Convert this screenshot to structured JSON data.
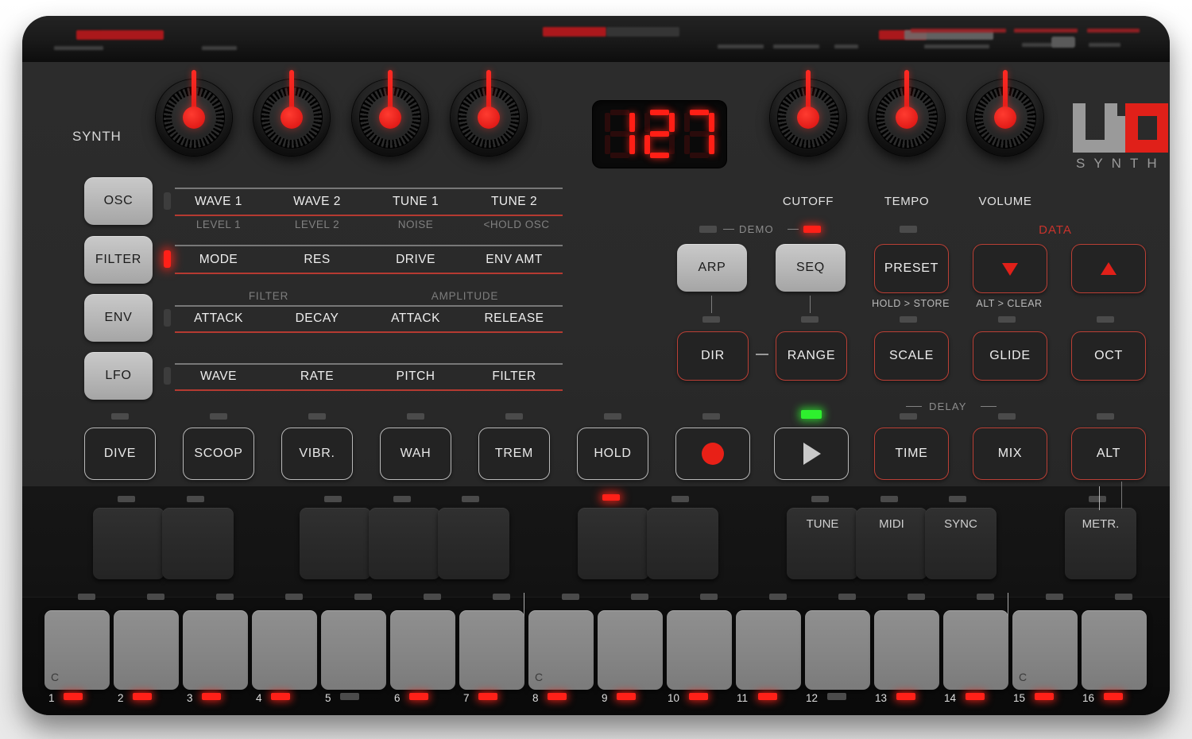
{
  "device": {
    "brand_logo": "UNO",
    "brand_sub": "SYNTH",
    "section_title": "SYNTH"
  },
  "display": {
    "value": "127",
    "digits": [
      "1",
      "2",
      "7"
    ]
  },
  "synth_section_buttons": [
    {
      "label": "OSC",
      "led": "off"
    },
    {
      "label": "FILTER",
      "led": "on"
    },
    {
      "label": "ENV",
      "led": "off"
    },
    {
      "label": "LFO",
      "led": "off"
    }
  ],
  "left_knobs": [
    {
      "label": "WAVE 1"
    },
    {
      "label": "WAVE 2"
    },
    {
      "label": "TUNE 1"
    },
    {
      "label": "TUNE 2"
    }
  ],
  "right_knobs": [
    {
      "label": "CUTOFF"
    },
    {
      "label": "TEMPO"
    },
    {
      "label": "VOLUME"
    }
  ],
  "param_rows": [
    {
      "row": "osc",
      "primary": [
        "WAVE 1",
        "WAVE 2",
        "TUNE 1",
        "TUNE 2"
      ],
      "secondary": [
        "LEVEL 1",
        "LEVEL 2",
        "NOISE",
        "<HOLD OSC"
      ],
      "group_labels": []
    },
    {
      "row": "filter",
      "primary": [
        "MODE",
        "RES",
        "DRIVE",
        "ENV AMT"
      ],
      "secondary": [],
      "group_labels": []
    },
    {
      "row": "env",
      "primary": [
        "ATTACK",
        "DECAY",
        "ATTACK",
        "RELEASE"
      ],
      "secondary": [],
      "group_labels": [
        "FILTER",
        "AMPLITUDE"
      ]
    },
    {
      "row": "lfo",
      "primary": [
        "WAVE",
        "RATE",
        "PITCH",
        "FILTER"
      ],
      "secondary": [],
      "group_labels": []
    }
  ],
  "sequencer_row": {
    "demo_label": "DEMO",
    "data_label": "DATA",
    "buttons": [
      {
        "label": "ARP",
        "style": "light",
        "led": "off"
      },
      {
        "label": "SEQ",
        "style": "light",
        "led": "on"
      },
      {
        "label": "PRESET",
        "style": "red-outline",
        "led": "off",
        "sublabel": "HOLD > STORE"
      },
      {
        "label": "▼",
        "style": "red-outline",
        "led": "off",
        "sublabel": "ALT > CLEAR",
        "icon": "triangle-down-icon"
      },
      {
        "label": "▲",
        "style": "red-outline",
        "led": "off",
        "icon": "triangle-up-icon"
      }
    ]
  },
  "mode_row": {
    "buttons": [
      {
        "label": "DIR",
        "style": "red-outline",
        "led": "off"
      },
      {
        "label": "RANGE",
        "style": "red-outline",
        "led": "off"
      },
      {
        "label": "SCALE",
        "style": "red-outline",
        "led": "off"
      },
      {
        "label": "GLIDE",
        "style": "red-outline",
        "led": "off"
      },
      {
        "label": "OCT",
        "style": "red-outline",
        "led": "off"
      }
    ],
    "connector": "—"
  },
  "perf_row": {
    "delay_label": "DELAY",
    "buttons": [
      {
        "label": "DIVE",
        "style": "white-outline",
        "led": "off"
      },
      {
        "label": "SCOOP",
        "style": "white-outline",
        "led": "off"
      },
      {
        "label": "VIBR.",
        "style": "white-outline",
        "led": "off"
      },
      {
        "label": "WAH",
        "style": "white-outline",
        "led": "off"
      },
      {
        "label": "TREM",
        "style": "white-outline",
        "led": "off"
      },
      {
        "label": "HOLD",
        "style": "white-outline",
        "led": "off"
      },
      {
        "label": "",
        "style": "white-outline",
        "led": "off",
        "icon": "record-icon"
      },
      {
        "label": "",
        "style": "white-outline",
        "led": "green",
        "icon": "play-icon"
      },
      {
        "label": "TIME",
        "style": "red-outline",
        "led": "off"
      },
      {
        "label": "MIX",
        "style": "red-outline",
        "led": "off"
      },
      {
        "label": "ALT",
        "style": "red-outline",
        "led": "off"
      }
    ]
  },
  "black_keys": [
    {
      "index": 1,
      "label": "",
      "led": "off"
    },
    {
      "index": 2,
      "label": "",
      "led": "off"
    },
    {
      "index": 3,
      "label": "",
      "led": "off"
    },
    {
      "index": 4,
      "label": "",
      "led": "off"
    },
    {
      "index": 5,
      "label": "",
      "led": "off"
    },
    {
      "index": 6,
      "label": "",
      "led": "on"
    },
    {
      "index": 7,
      "label": "",
      "led": "off"
    },
    {
      "index": 8,
      "label": "TUNE",
      "led": "off"
    },
    {
      "index": 9,
      "label": "MIDI",
      "led": "off"
    },
    {
      "index": 10,
      "label": "SYNC",
      "led": "off"
    },
    {
      "index": 11,
      "label": "METR.",
      "led": "off"
    }
  ],
  "white_keys": [
    {
      "num": "1",
      "note": "C",
      "led": "on"
    },
    {
      "num": "2",
      "note": "",
      "led": "on"
    },
    {
      "num": "3",
      "note": "",
      "led": "on"
    },
    {
      "num": "4",
      "note": "",
      "led": "on"
    },
    {
      "num": "5",
      "note": "",
      "led": "off"
    },
    {
      "num": "6",
      "note": "",
      "led": "on"
    },
    {
      "num": "7",
      "note": "",
      "led": "on"
    },
    {
      "num": "8",
      "note": "C",
      "led": "on"
    },
    {
      "num": "9",
      "note": "",
      "led": "on"
    },
    {
      "num": "10",
      "note": "",
      "led": "on"
    },
    {
      "num": "11",
      "note": "",
      "led": "on"
    },
    {
      "num": "12",
      "note": "",
      "led": "off"
    },
    {
      "num": "13",
      "note": "",
      "led": "on"
    },
    {
      "num": "14",
      "note": "",
      "led": "on"
    },
    {
      "num": "15",
      "note": "C",
      "led": "on"
    },
    {
      "num": "16",
      "note": "",
      "led": "on"
    }
  ],
  "colors": {
    "accent_red": "#c9332c",
    "led_red": "#ff2018",
    "led_green": "#2ef02e",
    "panel": "#2a2a2a",
    "key_white": "#878787"
  }
}
